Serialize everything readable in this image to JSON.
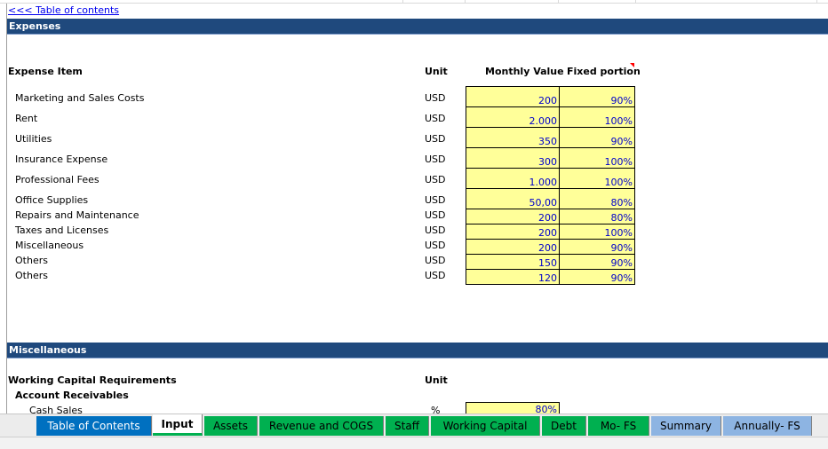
{
  "toc_link": "<<< Table of contents",
  "expenses": {
    "section_title": "Expenses",
    "col_item": "Expense Item",
    "col_unit": "Unit",
    "col_monthly": "Monthly Value",
    "col_fixed": "Fixed portion",
    "rows": [
      {
        "item": "Marketing and Sales Costs",
        "unit": "USD",
        "monthly": "200",
        "fixed": "90%"
      },
      {
        "item": "Rent",
        "unit": "USD",
        "monthly": "2.000",
        "fixed": "100%"
      },
      {
        "item": "Utilities",
        "unit": "USD",
        "monthly": "350",
        "fixed": "90%"
      },
      {
        "item": "Insurance Expense",
        "unit": "USD",
        "monthly": "300",
        "fixed": "100%"
      },
      {
        "item": "Professional Fees",
        "unit": "USD",
        "monthly": "1.000",
        "fixed": "100%"
      },
      {
        "item": "Office Supplies",
        "unit": "USD",
        "monthly": "50,00",
        "fixed": "80%"
      },
      {
        "item": "Repairs and Maintenance",
        "unit": "USD",
        "monthly": "200",
        "fixed": "80%"
      },
      {
        "item": "Taxes and Licenses",
        "unit": "USD",
        "monthly": "200",
        "fixed": "100%"
      },
      {
        "item": "Miscellaneous",
        "unit": "USD",
        "monthly": "200",
        "fixed": "90%"
      },
      {
        "item": "Others",
        "unit": "USD",
        "monthly": "150",
        "fixed": "90%"
      },
      {
        "item": "Others",
        "unit": "USD",
        "monthly": "120",
        "fixed": "90%"
      }
    ]
  },
  "misc": {
    "section_title": "Miscellaneous",
    "col_item": "Working Capital Requirements",
    "col_unit": "Unit",
    "sub_header": "Account Receivables",
    "row_item": "Cash Sales",
    "row_unit": "%",
    "row_value": "80%"
  },
  "tabs": [
    {
      "label": "Table of Contents",
      "style": "blue"
    },
    {
      "label": "Input",
      "style": "active"
    },
    {
      "label": "Assets",
      "style": "green"
    },
    {
      "label": "Revenue and COGS",
      "style": "green"
    },
    {
      "label": "Staff",
      "style": "green"
    },
    {
      "label": "Working Capital",
      "style": "green"
    },
    {
      "label": "Debt",
      "style": "green"
    },
    {
      "label": "Mo- FS",
      "style": "green"
    },
    {
      "label": "Summary",
      "style": "lblue"
    },
    {
      "label": "Annually- FS",
      "style": "lblue"
    }
  ],
  "colors": {
    "section_bar": "#1f497d",
    "input_cell": "#ffff99",
    "input_text": "#0000cc",
    "tab_green": "#00b050",
    "tab_blue": "#0070c0",
    "tab_light_blue": "#8db4e2"
  }
}
